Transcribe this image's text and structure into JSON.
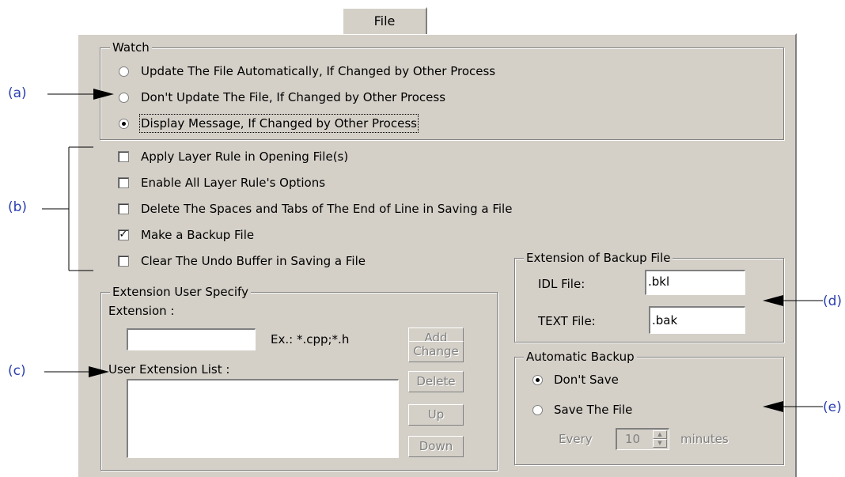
{
  "tab": {
    "label": "File"
  },
  "watch": {
    "title": "Watch",
    "options": [
      {
        "label": "Update The File Automatically, If Changed by Other Process",
        "selected": false
      },
      {
        "label": "Don't Update The File, If Changed by Other Process",
        "selected": false
      },
      {
        "label": "Display Message, If Changed by Other Process",
        "selected": true
      }
    ]
  },
  "checkboxes": [
    {
      "label": "Apply Layer Rule in Opening File(s)",
      "checked": false
    },
    {
      "label": "Enable All Layer Rule's Options",
      "checked": false
    },
    {
      "label": "Delete The Spaces and Tabs of The End of Line in Saving a File",
      "checked": false
    },
    {
      "label": "Make a Backup File",
      "checked": true
    },
    {
      "label": "Clear The Undo Buffer in Saving a File",
      "checked": false
    }
  ],
  "extension_user": {
    "title": "Extension User Specify",
    "extension_label": "Extension :",
    "extension_value": "",
    "example": "Ex.: *.cpp;*.h",
    "list_label": "User Extension List :",
    "buttons": {
      "add": "Add",
      "change": "Change",
      "delete": "Delete",
      "up": "Up",
      "down": "Down"
    }
  },
  "backup_extension": {
    "title": "Extension of Backup File",
    "idl_label": "IDL File:",
    "idl_value": ".bkl",
    "text_label": "TEXT File:",
    "text_value": ".bak"
  },
  "auto_backup": {
    "title": "Automatic Backup",
    "dont_save": "Don't Save",
    "save_file": "Save The File",
    "every_label": "Every",
    "minutes_value": "10",
    "minutes_label": "minutes",
    "selected": "dont_save"
  },
  "callouts": {
    "a": "(a)",
    "b": "(b)",
    "c": "(c)",
    "d": "(d)",
    "e": "(e)"
  }
}
